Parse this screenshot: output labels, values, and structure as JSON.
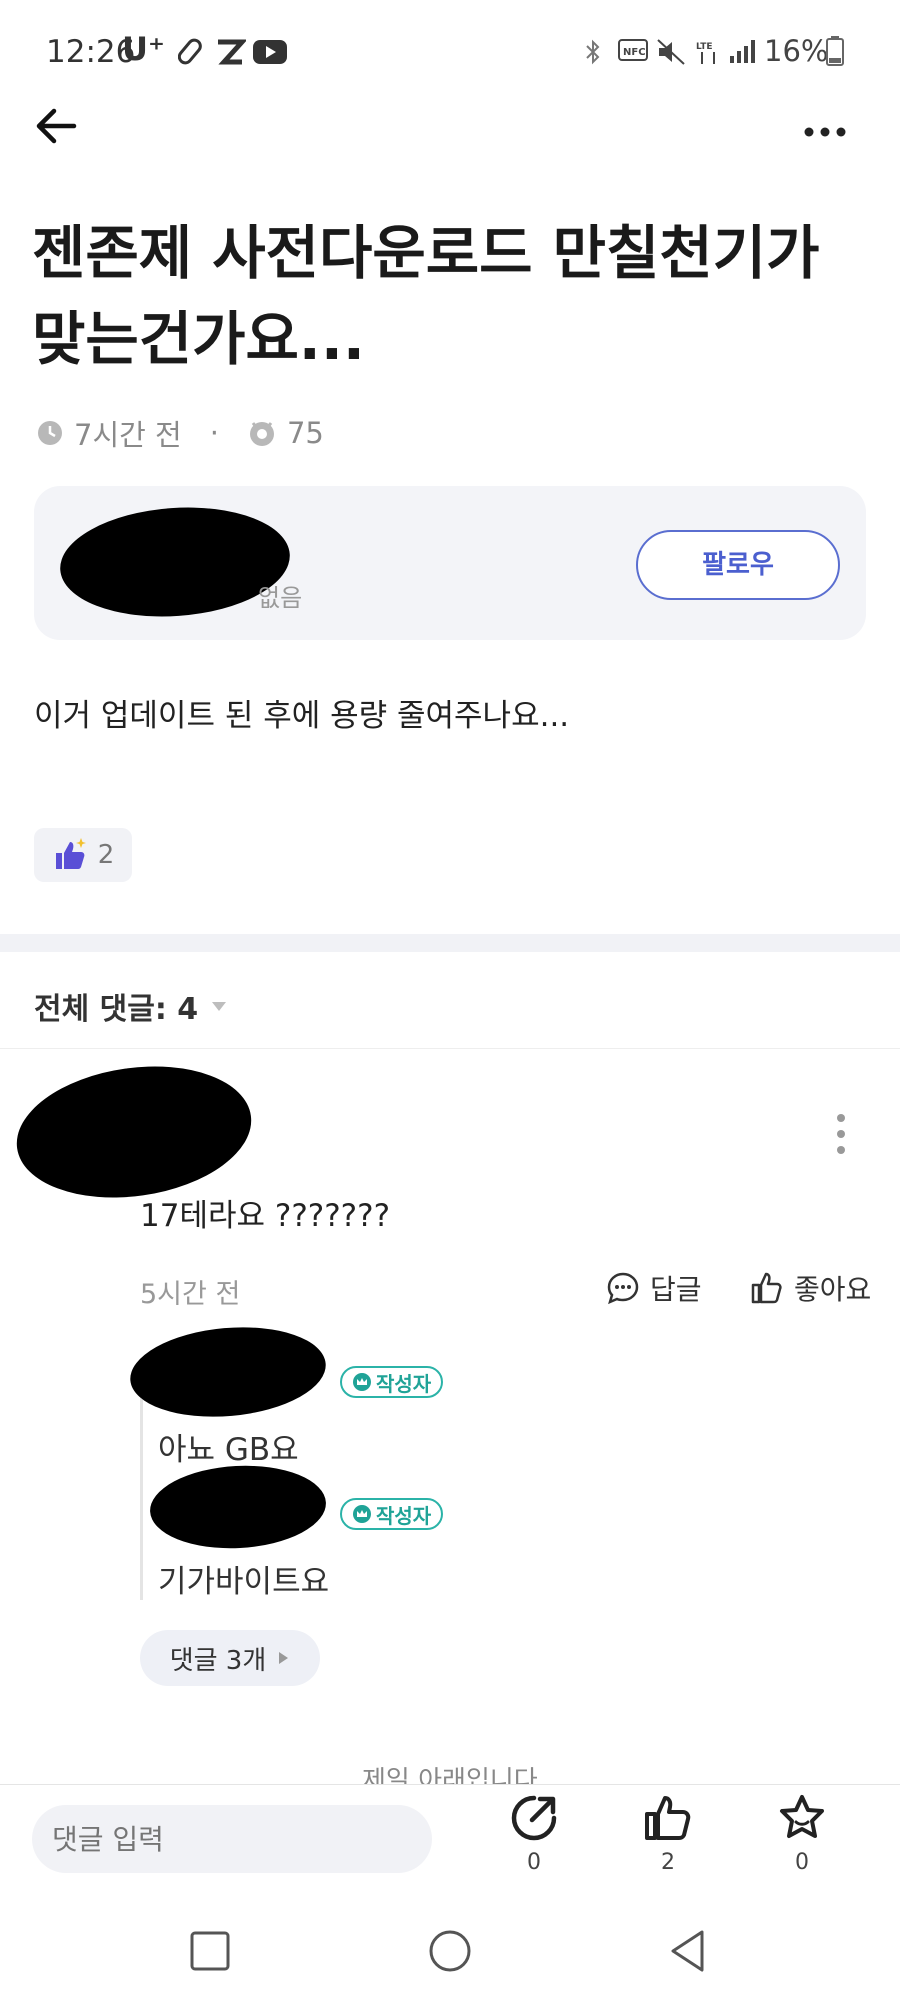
{
  "status_bar": {
    "time": "12:26",
    "carrier": "U⁺",
    "battery": "16%"
  },
  "post": {
    "title": "젠존제 사전다운로드 만칠천기가 맞는건가요...",
    "time_ago": "7시간 전",
    "views": "75",
    "body": "이거 업데이트 된 후에 용량 줄여주나요...",
    "like_count": "2"
  },
  "author": {
    "follow_label": "팔로우",
    "partial_text": "없음"
  },
  "comments_section": {
    "header": "전체 댓글: 4",
    "comment": {
      "text": "17테라요 ???????",
      "time_ago": "5시간 전",
      "reply_label": "답글",
      "like_label": "좋아요",
      "replies": [
        {
          "badge": "작성자",
          "text": "아뇨 GB요"
        },
        {
          "badge": "작성자",
          "text": "기가바이트요"
        }
      ],
      "more_replies_label": "댓글 3개"
    },
    "bottom_notice": "제일 아래입니다"
  },
  "bottom_bar": {
    "input_placeholder": "댓글 입력",
    "share_count": "0",
    "like_count": "2",
    "star_count": "0"
  },
  "colors": {
    "accent": "#4b5fcf",
    "badge": "#1fa397",
    "card_bg": "#f3f4f8"
  }
}
